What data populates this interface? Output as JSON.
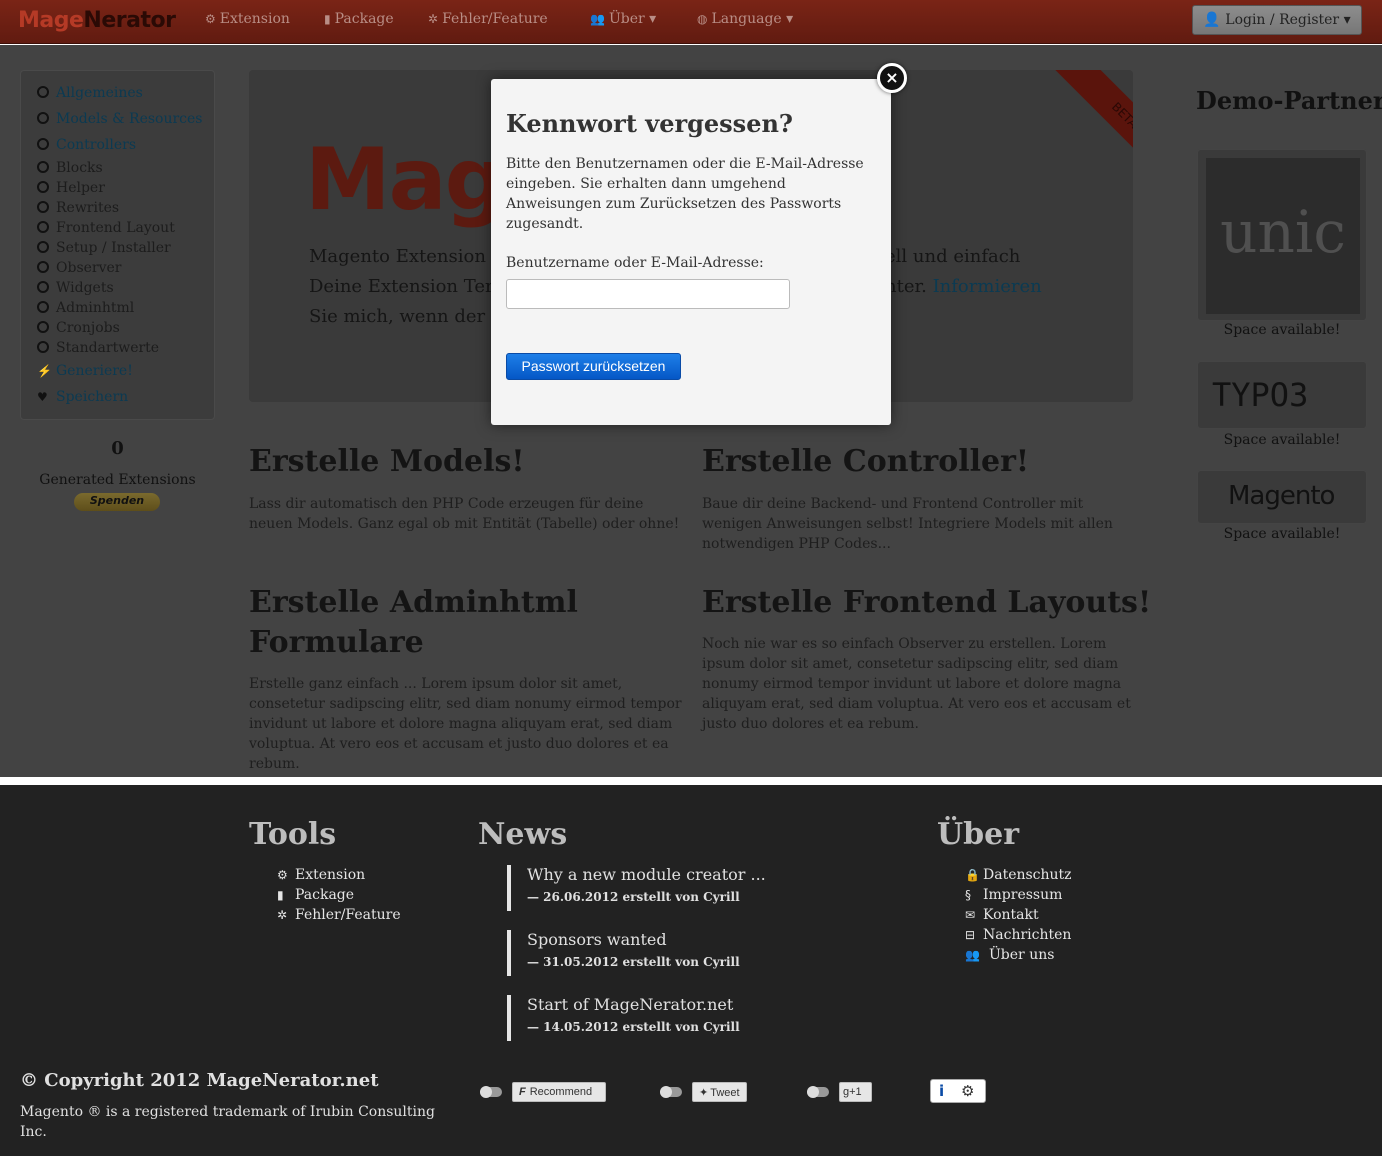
{
  "brand": {
    "part1": "Mage",
    "part2": "Nerator"
  },
  "nav": {
    "extension": "Extension",
    "package": "Package",
    "bugs": "Fehler/Feature",
    "about": "Über",
    "language": "Language",
    "login": "Login / Register"
  },
  "sidebar": {
    "items": [
      {
        "label": "Allgemeines"
      },
      {
        "label": "Models & Resources"
      },
      {
        "label": "Controllers"
      },
      {
        "label": "Blocks"
      },
      {
        "label": "Helper"
      },
      {
        "label": "Rewrites"
      },
      {
        "label": "Frontend Layout"
      },
      {
        "label": "Setup / Installer"
      },
      {
        "label": "Observer"
      },
      {
        "label": "Widgets"
      },
      {
        "label": "Adminhtml"
      },
      {
        "label": "Cronjobs"
      },
      {
        "label": "Standartwerte"
      },
      {
        "label": "Generiere!"
      },
      {
        "label": "Speichern"
      }
    ],
    "generated_count": "0",
    "generated_label": "Generated Extensions",
    "donate": "Spenden"
  },
  "hero": {
    "big": "Mag",
    "line1": "Magento Extension",
    "line1_right": "ell und einfach",
    "line2": "Deine Extension Ter",
    "line2_right": "nter.",
    "line2_link": "Informieren",
    "line3": "Sie mich, wenn der S",
    "ribbon": "BETA"
  },
  "sections": [
    {
      "title": "Erstelle Models!",
      "text": "Lass dir automatisch den PHP Code erzeugen für deine neuen Models. Ganz egal ob mit Entität (Tabelle) oder ohne!"
    },
    {
      "title": "Erstelle Controller!",
      "text": "Baue dir deine Backend- und Frontend Controller mit wenigen Anweisungen selbst! Integriere Models mit allen notwendigen PHP Codes..."
    },
    {
      "title": "Erstelle Adminhtml Formulare",
      "text": "Erstelle ganz einfach ... Lorem ipsum dolor sit amet, consetetur sadipscing elitr, sed diam nonumy eirmod tempor invidunt ut labore et dolore magna aliquyam erat, sed diam voluptua. At vero eos et accusam et justo duo dolores et ea rebum."
    },
    {
      "title": "Erstelle Frontend Layouts!",
      "text": "Noch nie war es so einfach Observer zu erstellen. Lorem ipsum dolor sit amet, consetetur sadipscing elitr, sed diam nonumy eirmod tempor invidunt ut labore et dolore magna aliquyam erat, sed diam voluptua. At vero eos et accusam et justo duo dolores et ea rebum."
    }
  ],
  "partners": {
    "title": "Demo-Partner",
    "logos": [
      "unic",
      "TYPO3",
      "Magento"
    ],
    "space": "Space available!"
  },
  "modal": {
    "title": "Kennwort vergessen?",
    "description": "Bitte den Benutzernamen oder die E-Mail-Adresse eingeben. Sie erhalten dann umgehend Anweisungen zum Zurücksetzen des Passworts zugesandt.",
    "field_label": "Benutzername oder E-Mail-Adresse:",
    "field_value": "",
    "submit": "Passwort zurücksetzen",
    "close": "×"
  },
  "footer": {
    "tools": {
      "title": "Tools",
      "links": [
        "Extension",
        "Package",
        "Fehler/Feature"
      ]
    },
    "news": {
      "title": "News",
      "items": [
        {
          "title": "Why a new module creator ...",
          "meta": "— 26.06.2012 erstellt von Cyrill"
        },
        {
          "title": "Sponsors wanted",
          "meta": "— 31.05.2012 erstellt von Cyrill"
        },
        {
          "title": "Start of MageNerator.net",
          "meta": "— 14.05.2012 erstellt von Cyrill"
        }
      ]
    },
    "about": {
      "title": "Über",
      "links": [
        "Datenschutz",
        "Impressum",
        "Kontakt",
        "Nachrichten",
        "Über uns"
      ]
    },
    "copyright": "© Copyright 2012 MageNerator.net",
    "trademark": "Magento ® is a registered trademark of Irubin Consulting Inc.",
    "social": {
      "facebook": "Recommend",
      "twitter": "Tweet",
      "gplus": "+1"
    }
  }
}
